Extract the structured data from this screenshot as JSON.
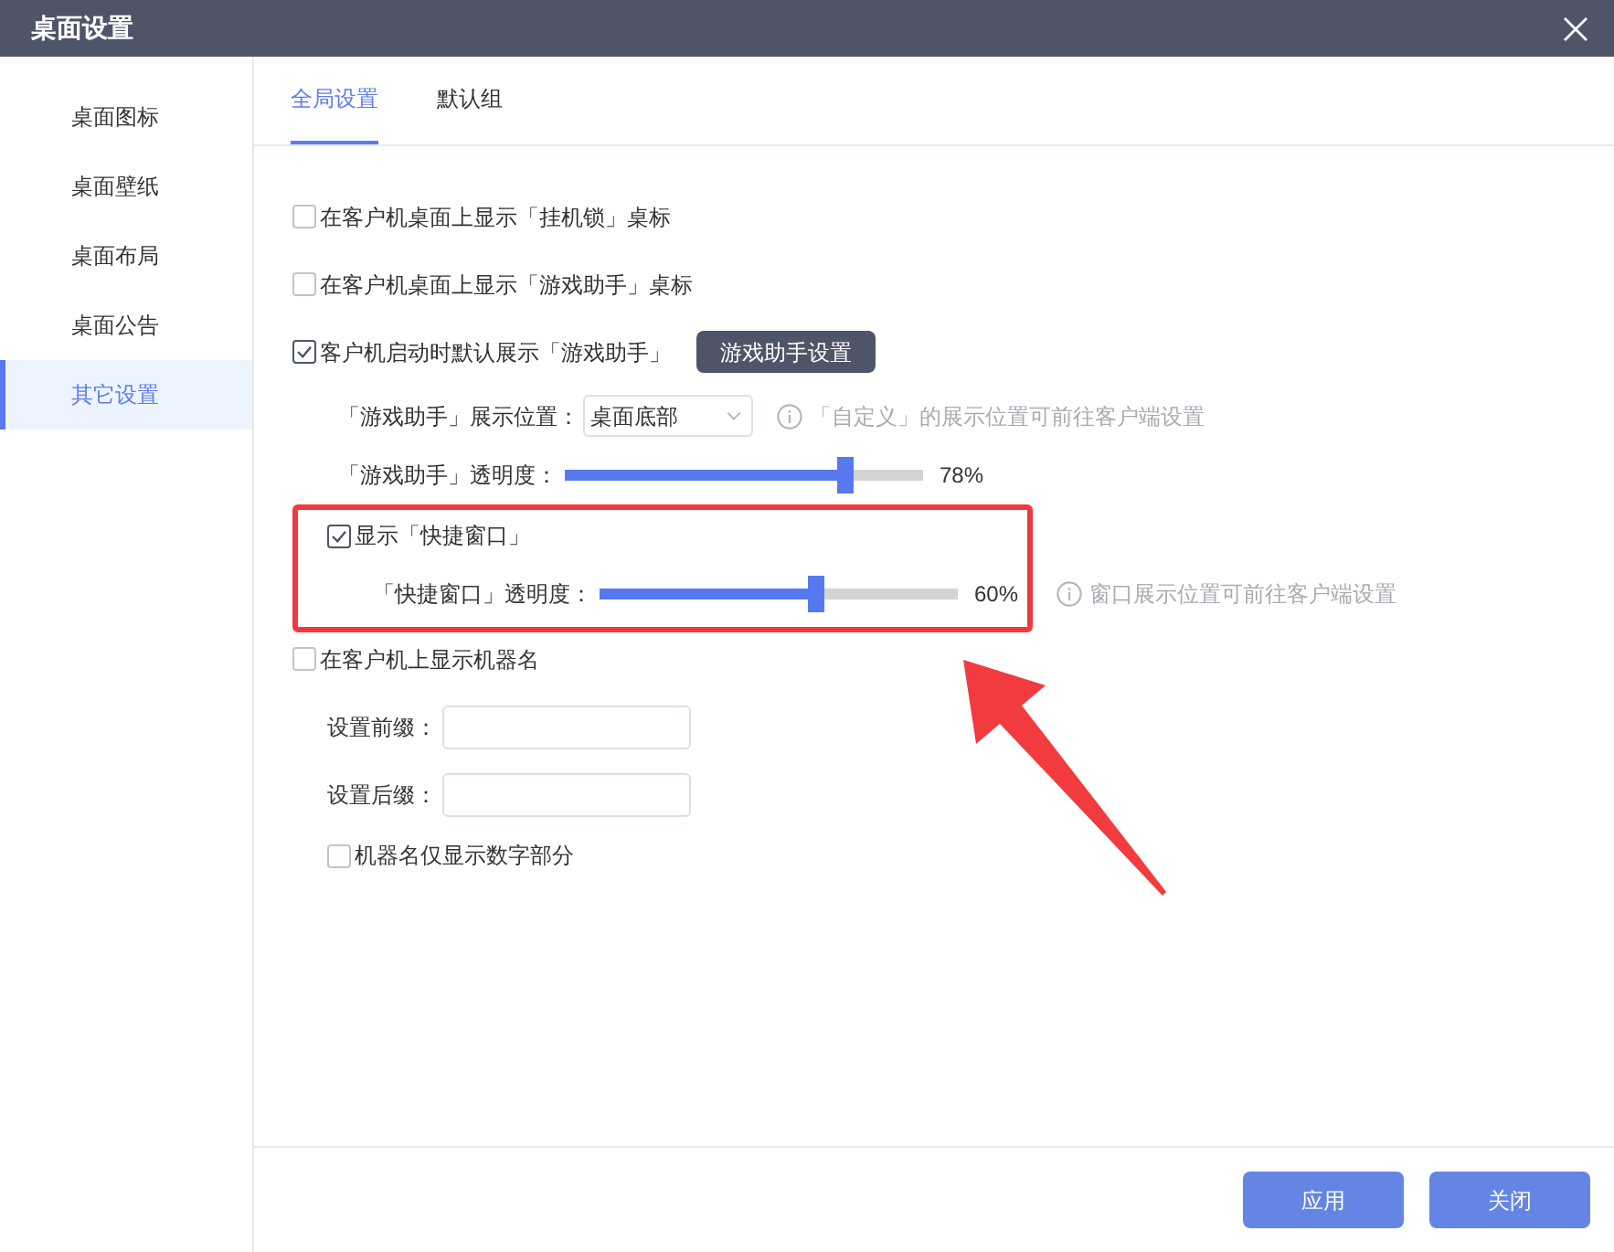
{
  "window": {
    "title": "桌面设置"
  },
  "sidebar": {
    "items": [
      {
        "label": "桌面图标",
        "selected": false
      },
      {
        "label": "桌面壁纸",
        "selected": false
      },
      {
        "label": "桌面布局",
        "selected": false
      },
      {
        "label": "桌面公告",
        "selected": false
      },
      {
        "label": "其它设置",
        "selected": true
      }
    ]
  },
  "tabs": [
    {
      "label": "全局设置",
      "selected": true
    },
    {
      "label": "默认组",
      "selected": false
    }
  ],
  "settings": [
    {
      "kind": "checkbox",
      "label": "在客户机桌面上显示「挂机锁」桌标",
      "checked": false
    },
    {
      "kind": "checkbox",
      "label": "在客户机桌面上显示「游戏助手」桌标",
      "checked": false
    },
    {
      "kind": "checkbox",
      "label": "客户机启动时默认展示「游戏助手」",
      "checked": true,
      "button": "游戏助手设置",
      "children": [
        {
          "kind": "select",
          "label": "「游戏助手」展示位置：",
          "value": "桌面底部",
          "hint": "「自定义」的展示位置可前往客户端设置"
        },
        {
          "kind": "slider",
          "label": "「游戏助手」透明度：",
          "level": 0.78,
          "reading": "78%"
        },
        {
          "kind": "checkbox",
          "label": "显示「快捷窗口」",
          "checked": true,
          "highlighted": true,
          "children": [
            {
              "kind": "slider",
              "label": "「快捷窗口」透明度：",
              "level": 0.6,
              "reading": "60%",
              "hint": "窗口展示位置可前往客户端设置"
            }
          ]
        }
      ]
    },
    {
      "kind": "checkbox",
      "label": "在客户机上显示机器名",
      "checked": false,
      "children": [
        {
          "kind": "input",
          "label": "设置前缀："
        },
        {
          "kind": "input",
          "label": "设置后缀："
        },
        {
          "kind": "checkbox",
          "label": "机器名仅显示数字部分",
          "checked": false
        }
      ]
    }
  ],
  "buttons": [
    "应用",
    "关闭"
  ]
}
